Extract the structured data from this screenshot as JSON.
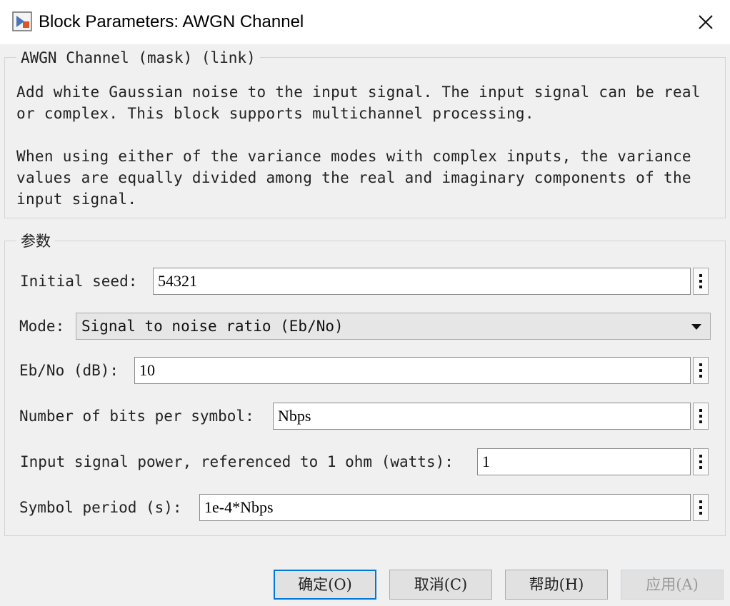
{
  "window": {
    "title": "Block Parameters: AWGN Channel",
    "close_icon": "close-icon",
    "app_icon": "simulink-block-icon"
  },
  "description_group": {
    "legend": "AWGN Channel (mask) (link)",
    "lines": [
      "Add white Gaussian noise to the input signal. The input signal can be real",
      "or complex. This block supports multichannel processing.",
      "",
      "When using either of the variance modes with complex inputs, the variance",
      "values are equally divided among the real and imaginary components of the",
      "input signal."
    ]
  },
  "params_group": {
    "legend": "参数",
    "initial_seed": {
      "label": "Initial seed:",
      "value": "54321"
    },
    "mode": {
      "label": "Mode:",
      "value": "Signal to noise ratio  (Eb/No)"
    },
    "ebno": {
      "label": "Eb/No (dB):",
      "value": "10"
    },
    "bits_per_symbol": {
      "label": "Number of bits per symbol:",
      "value": "Nbps"
    },
    "input_power": {
      "label": "Input signal power, referenced to 1 ohm (watts):",
      "value": "1"
    },
    "symbol_period": {
      "label": "Symbol period (s):",
      "value": "1e-4*Nbps"
    }
  },
  "buttons": {
    "ok": "确定(O)",
    "cancel": "取消(C)",
    "help": "帮助(H)",
    "apply": "应用(A)"
  }
}
